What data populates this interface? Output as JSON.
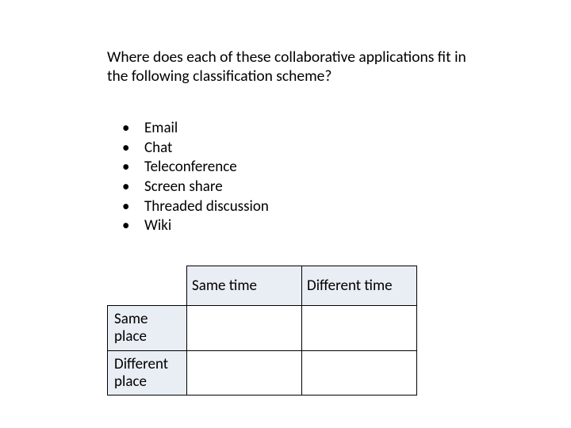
{
  "question": "Where does each of these collaborative applications fit in the following classification scheme?",
  "apps": [
    "Email",
    "Chat",
    "Teleconference",
    "Screen share",
    "Threaded discussion",
    "Wiki"
  ],
  "matrix": {
    "cols": [
      "Same time",
      "Different time"
    ],
    "rows": [
      "Same place",
      "Different place"
    ],
    "cells": [
      [
        "",
        ""
      ],
      [
        "",
        ""
      ]
    ]
  }
}
